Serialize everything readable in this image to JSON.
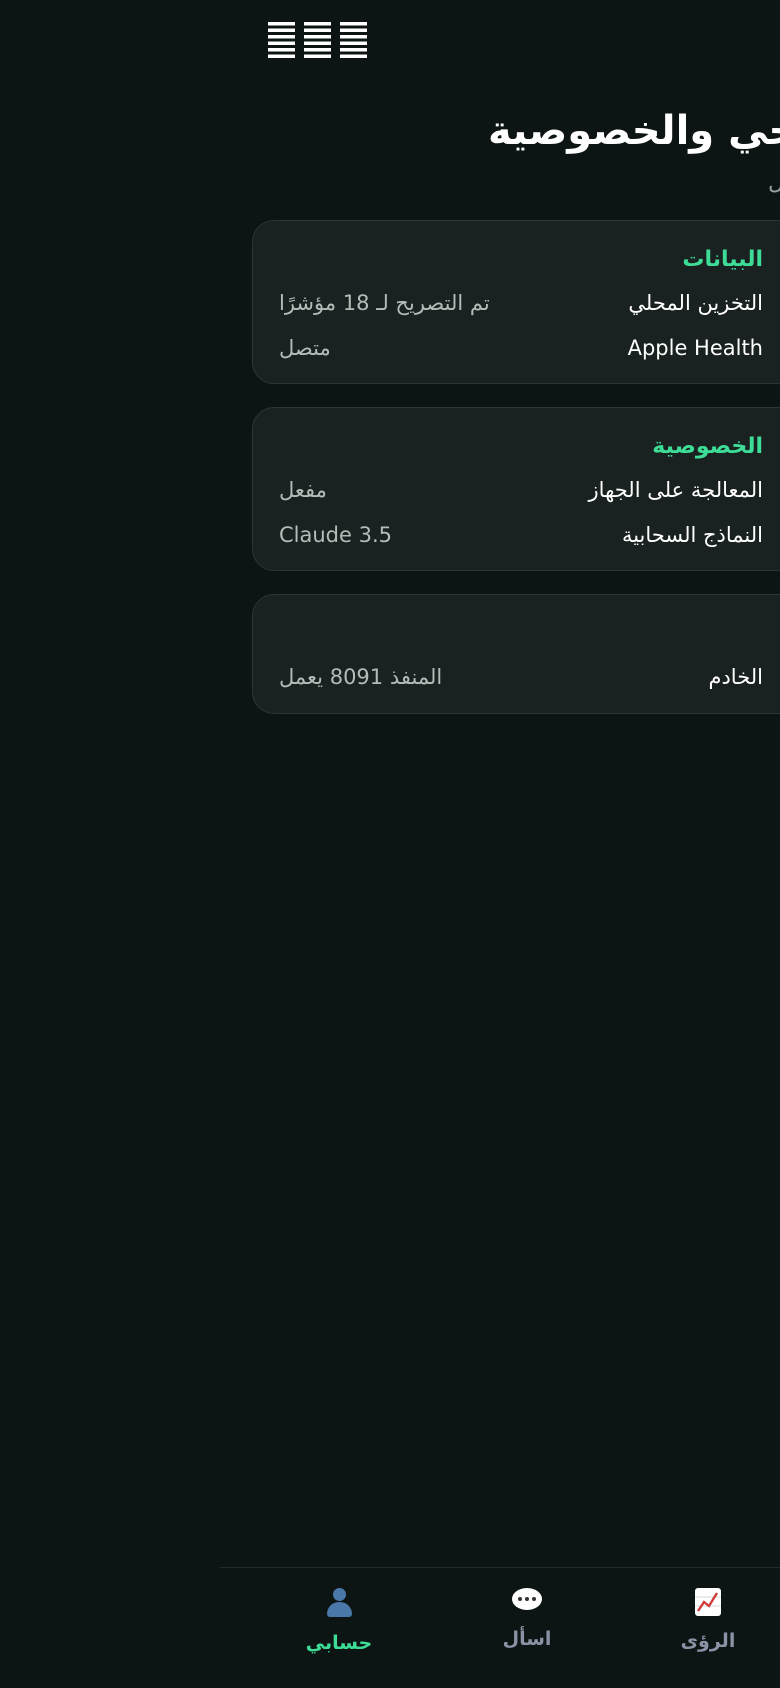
{
  "header": {
    "title": "الوضع الصحي والخصوصية",
    "subtitle": "الحالة والاتصال"
  },
  "cards": [
    {
      "title": "البيانات",
      "rows": [
        {
          "key": "التخزين المحلي",
          "value": "تم التصريح لـ 18 مؤشرًا"
        },
        {
          "key": "Apple Health",
          "value": "متصل"
        }
      ]
    },
    {
      "title": "الخصوصية",
      "rows": [
        {
          "key": "المعالجة على الجهاز",
          "value": "مفعل"
        },
        {
          "key": "النماذج السحابية",
          "value": "Claude 3.5"
        }
      ]
    },
    {
      "title": "",
      "rows": [
        {
          "key": "الخادم",
          "value": "المنفذ 8091 يعمل"
        }
      ]
    }
  ],
  "tabbar": {
    "tabs": [
      {
        "label": "حسابي",
        "icon": "person-icon",
        "active": true
      },
      {
        "label": "اسأل",
        "icon": "chat-bubble-icon",
        "active": false
      },
      {
        "label": "الرؤى",
        "icon": "chart-icon",
        "active": false
      }
    ]
  },
  "colors": {
    "background": "#0d1514",
    "card": "#1a2221",
    "accent": "#3ddc97",
    "muted": "#9aa3a1"
  }
}
